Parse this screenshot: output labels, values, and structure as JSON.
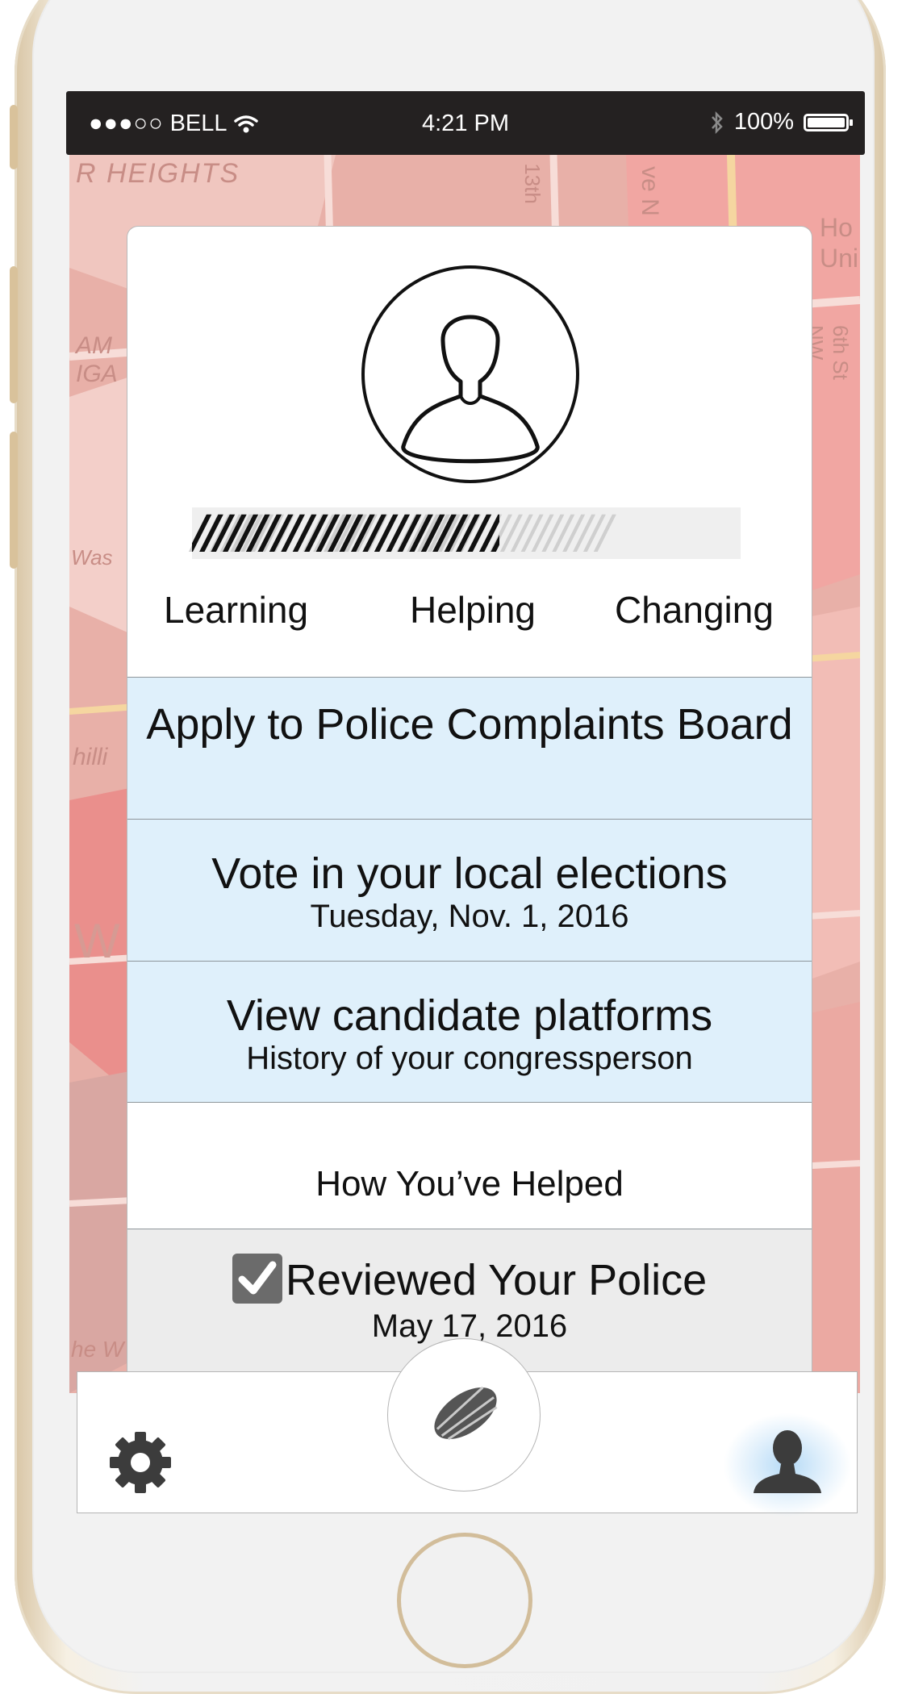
{
  "status_bar": {
    "signal": "●●●○○",
    "carrier": "BELL",
    "time": "4:21 PM",
    "battery_percent": "100%",
    "battery_level": 1.0,
    "icons": [
      "wifi-icon",
      "bluetooth-icon",
      "battery-icon"
    ]
  },
  "map": {
    "labels": [
      "R HEIGHTS",
      "13th",
      "ve N",
      "Ho",
      "Uni",
      "6th St NW",
      "AM",
      "IGA",
      "Was",
      "hilli",
      "W",
      "he W"
    ]
  },
  "profile": {
    "avatar_icon": "user-avatar-icon",
    "progress_fraction": 0.56,
    "stages": [
      "Learning",
      "Helping",
      "Changing"
    ]
  },
  "tasks": [
    {
      "title": "Apply to Police Complaints Board",
      "subtitle": ""
    },
    {
      "title": "Vote in your local elections",
      "subtitle": "Tuesday, Nov. 1, 2016"
    },
    {
      "title": "View candidate platforms",
      "subtitle": "History of your congressperson"
    }
  ],
  "helped": {
    "heading": "How You’ve Helped",
    "items": [
      {
        "title": "Reviewed Your Police",
        "date": "May 17, 2016",
        "checked": true
      }
    ]
  },
  "tabbar": {
    "left_icon": "gear-icon",
    "center_icon": "seed-icon",
    "right_icon": "person-icon"
  },
  "colors": {
    "task_bg": "#dff0fb",
    "done_bg": "#ececec",
    "status_bar_bg": "#242121",
    "map_bg": "#ebb5ae",
    "active_glow": "#a9d4f5"
  }
}
